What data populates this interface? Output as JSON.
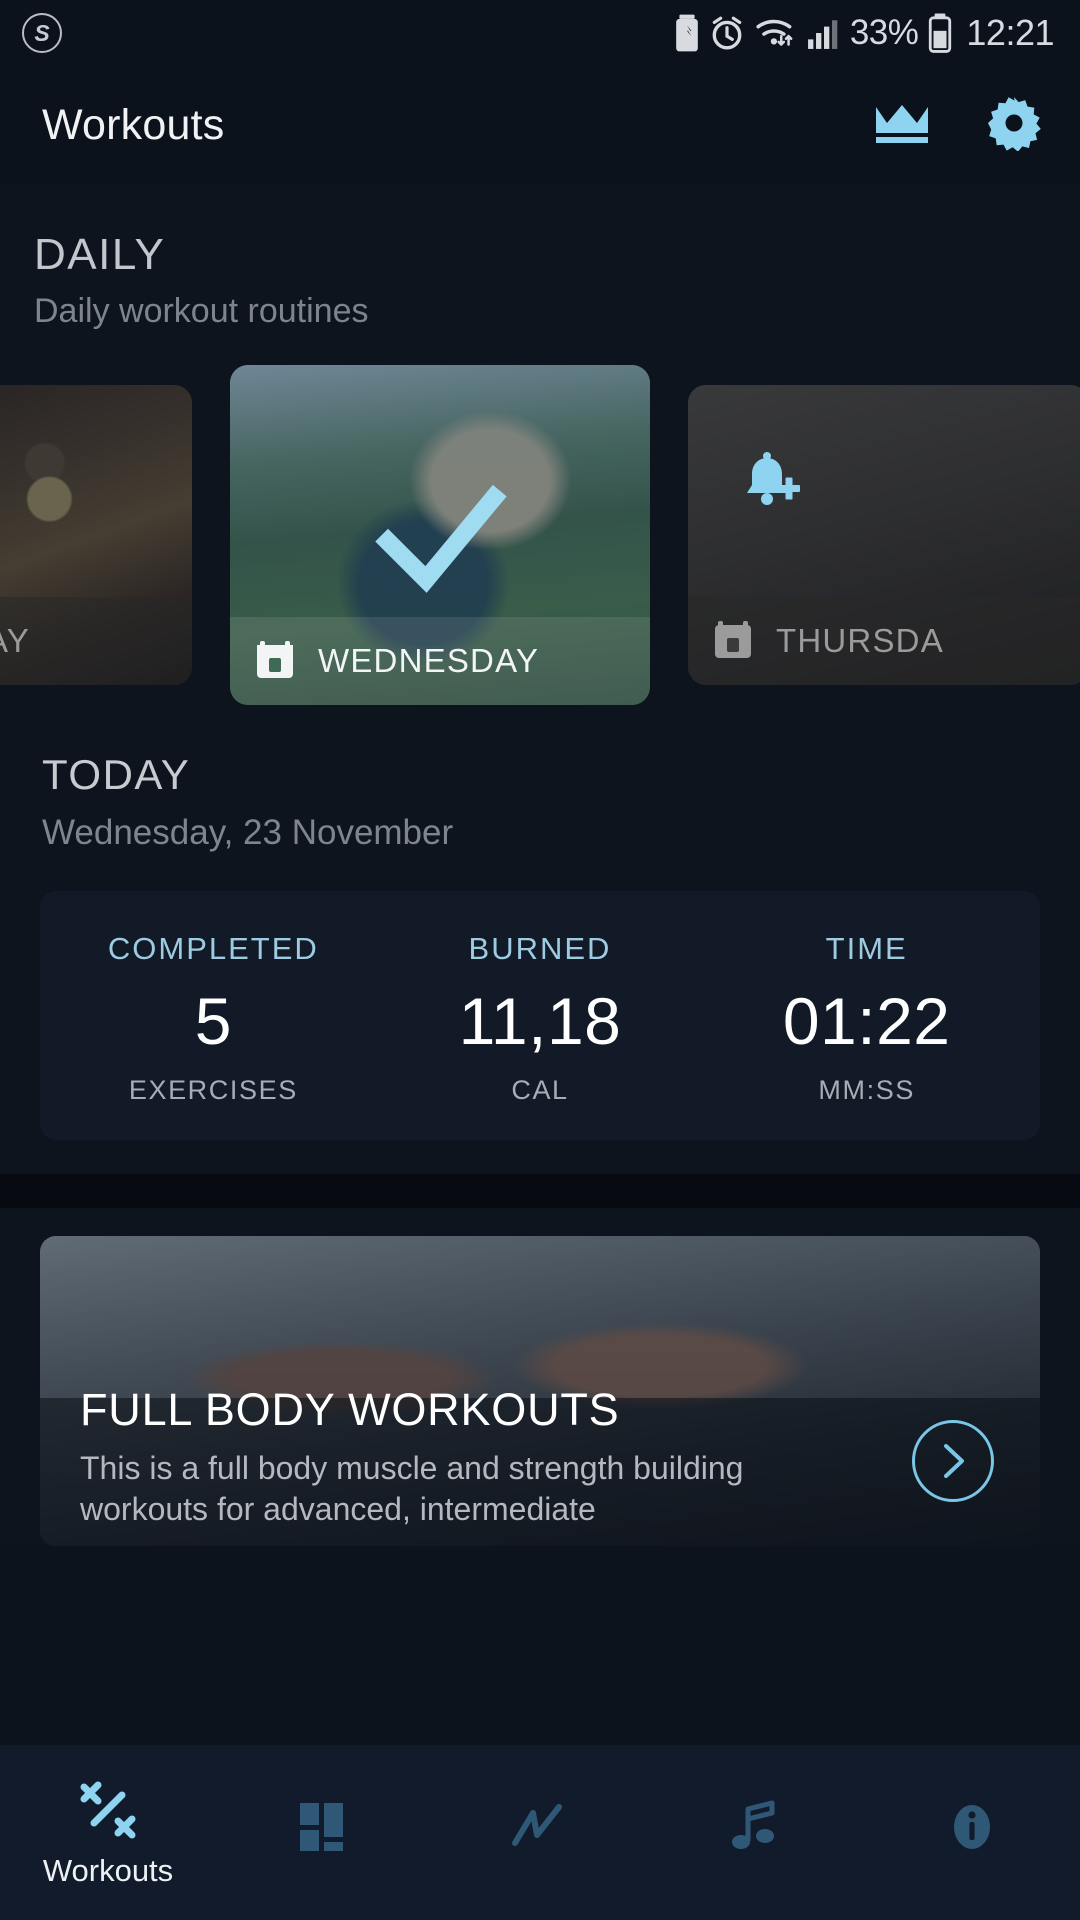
{
  "status_bar": {
    "app_logo": "s-circle-logo-icon",
    "icons": [
      "battery-saver-icon",
      "alarm-icon",
      "wifi-icon",
      "signal-icon"
    ],
    "battery_percent": "33%",
    "battery_icon": "battery-icon",
    "time": "12:21"
  },
  "app_bar": {
    "title": "Workouts",
    "premium_icon": "crown-icon",
    "settings_icon": "gear-icon"
  },
  "daily": {
    "title": "DAILY",
    "subtitle": "Daily workout routines",
    "cards": [
      {
        "day": "AY",
        "full_day": "TUESDAY",
        "state": "past",
        "calendar_icon": "calendar-icon",
        "image": "man-exercising-indoors"
      },
      {
        "day": "WEDNESDAY",
        "state": "completed",
        "calendar_icon": "calendar-icon",
        "check_icon": "check-icon",
        "image": "woman-plank-outdoors"
      },
      {
        "day": "THURSDA",
        "full_day": "THURSDAY",
        "state": "upcoming",
        "calendar_icon": "calendar-icon",
        "bell_icon": "bell-plus-icon",
        "image": "gym-equipment"
      }
    ]
  },
  "today": {
    "title": "TODAY",
    "date": "Wednesday, 23 November",
    "stats": [
      {
        "label": "COMPLETED",
        "value": "5",
        "unit": "EXERCISES"
      },
      {
        "label": "BURNED",
        "value": "11,18",
        "unit": "CAL"
      },
      {
        "label": "TIME",
        "value": "01:22",
        "unit": "MM:SS"
      }
    ]
  },
  "banner": {
    "title": "FULL BODY WORKOUTS",
    "description": "This is a full body muscle and strength building workouts for advanced, intermediate",
    "arrow_icon": "chevron-right-icon",
    "image": "man-and-woman-flexing"
  },
  "bottom_nav": {
    "items": [
      {
        "label": "Workouts",
        "icon": "dumbbell-icon",
        "active": true
      },
      {
        "label": "",
        "icon": "grid-dashboard-icon",
        "active": false
      },
      {
        "label": "",
        "icon": "progress-chart-icon",
        "active": false
      },
      {
        "label": "",
        "icon": "music-note-icon",
        "active": false
      },
      {
        "label": "",
        "icon": "info-icon",
        "active": false
      }
    ]
  },
  "colors": {
    "accent": "#8ed3f0",
    "background": "#0e141e",
    "card": "#111a26",
    "nav_background": "#111b2b",
    "nav_inactive": "#2f5876",
    "stat_label": "#9ecbe2"
  }
}
